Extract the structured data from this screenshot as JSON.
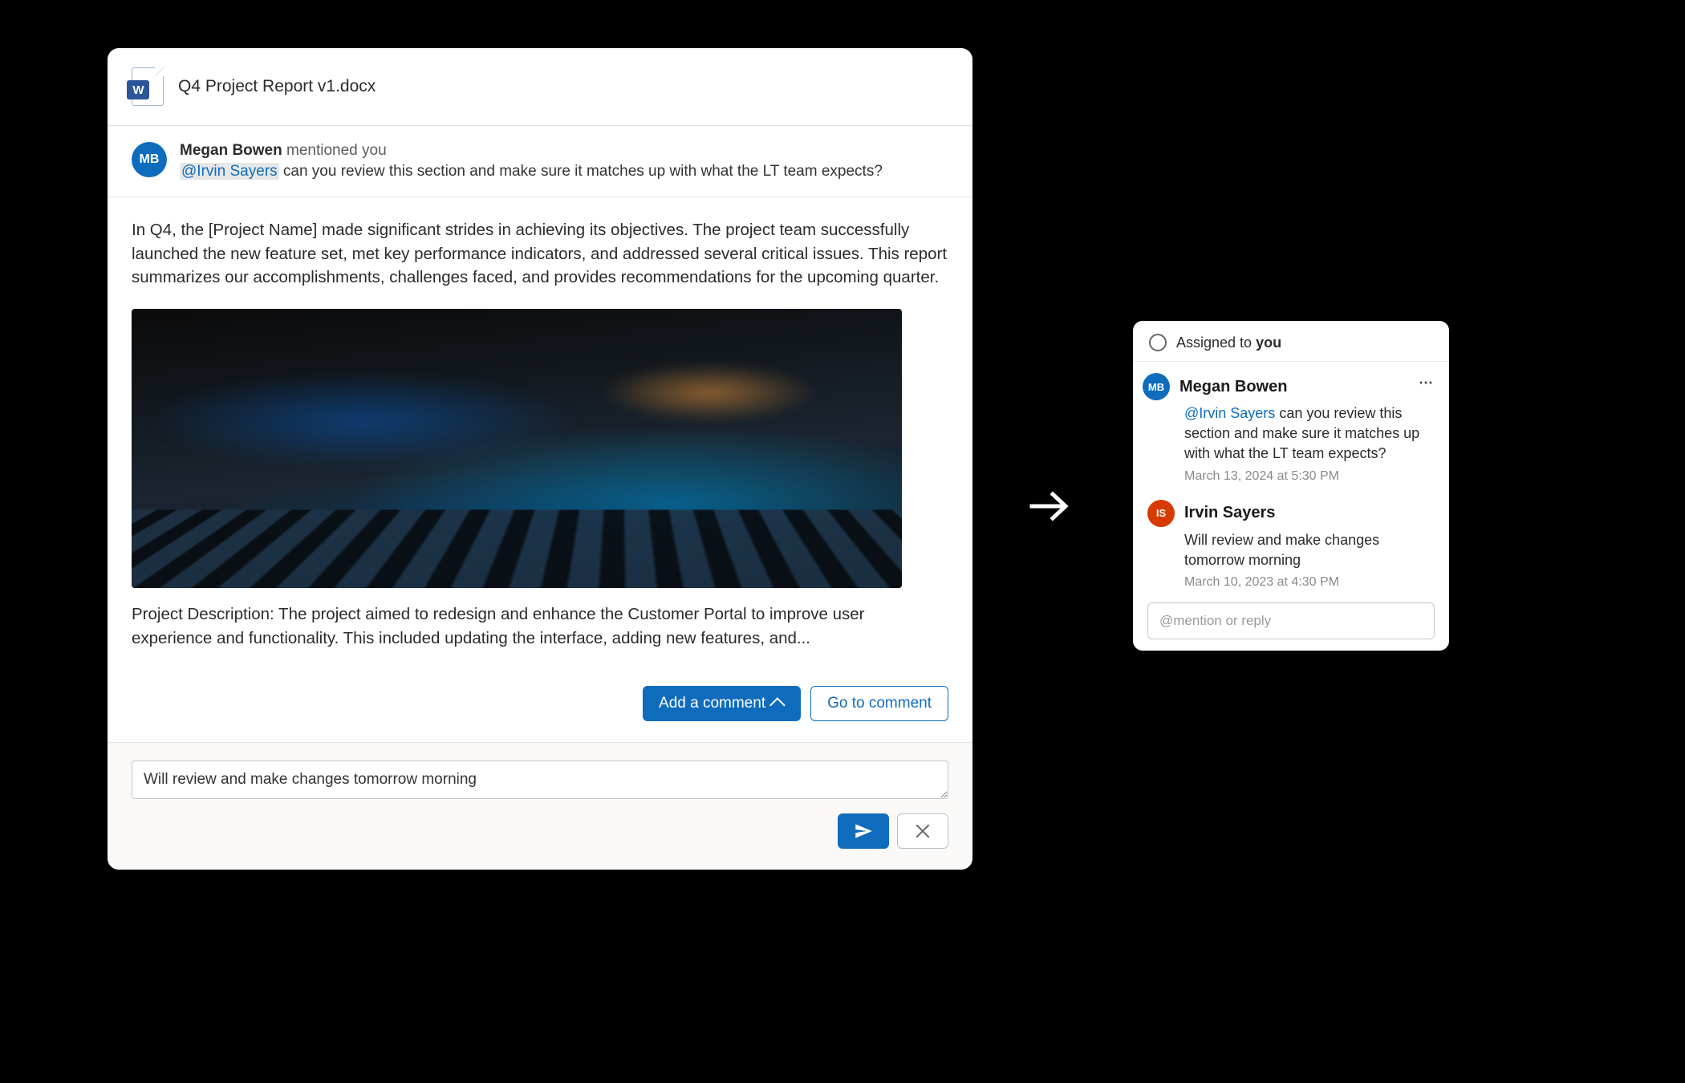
{
  "file": {
    "title": "Q4 Project Report v1.docx"
  },
  "mention": {
    "avatar_initials": "MB",
    "author_name": "Megan Bowen",
    "suffix": " mentioned you",
    "at_name": "@Irvin Sayers",
    "message_rest": " can you review this section and make sure it matches up with what the LT team expects?"
  },
  "doc": {
    "para1": "In Q4, the [Project Name] made significant strides in achieving its objectives. The project team successfully launched the new feature set, met key performance indicators, and addressed several critical issues. This report summarizes our accomplishments, challenges faced, and provides recommendations for the upcoming quarter.",
    "para2": "Project Description: The project aimed to redesign and enhance the Customer Portal to improve user experience and functionality. This included updating the interface, adding new features, and..."
  },
  "actions": {
    "add_comment": "Add a comment",
    "go_to_comment": "Go to comment"
  },
  "reply": {
    "text": "Will review and make changes tomorrow morning"
  },
  "thread": {
    "assigned_prefix": "Assigned to ",
    "assigned_you": "you",
    "reply_placeholder": "@mention or reply",
    "items": [
      {
        "initials": "MB",
        "avatar_color": "blue",
        "name": "Megan Bowen",
        "at_name": "@Irvin Sayers",
        "text_rest": " can you review this section and make sure it matches up with what the LT team expects?",
        "timestamp": "March 13, 2024 at 5:30 PM"
      },
      {
        "initials": "IS",
        "avatar_color": "red",
        "name": "Irvin Sayers",
        "text": "Will review and make changes tomorrow morning",
        "timestamp": "March 10, 2023 at 4:30 PM"
      }
    ]
  }
}
